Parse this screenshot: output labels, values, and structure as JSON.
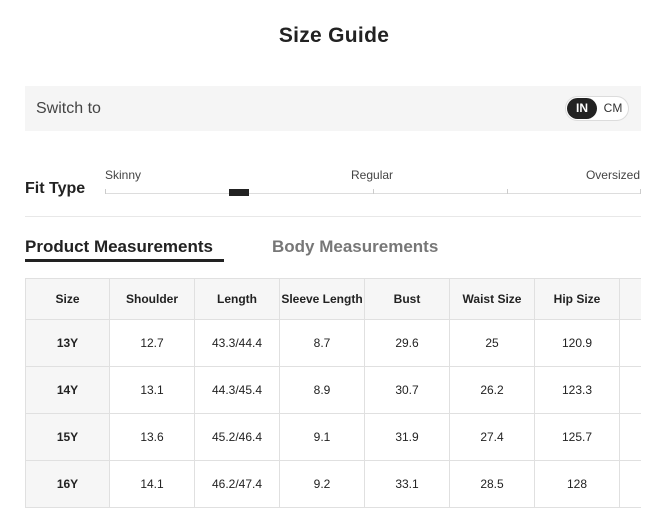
{
  "title": "Size Guide",
  "switch": {
    "label": "Switch to",
    "options": [
      "IN",
      "CM"
    ],
    "selected": "IN"
  },
  "fit_type": {
    "label": "Fit Type",
    "options": [
      "Skinny",
      "Regular",
      "Oversized"
    ],
    "level": 0.25
  },
  "tabs": [
    {
      "label": "Product Measurements",
      "active": true
    },
    {
      "label": "Body Measurements",
      "active": false
    }
  ],
  "table": {
    "headers": [
      "Size",
      "Shoulder",
      "Length",
      "Sleeve Length",
      "Bust",
      "Waist Size",
      "Hip Size",
      ""
    ],
    "rows": [
      [
        "13Y",
        "12.7",
        "43.3/44.4",
        "8.7",
        "29.6",
        "25",
        "120.9",
        ""
      ],
      [
        "14Y",
        "13.1",
        "44.3/45.4",
        "8.9",
        "30.7",
        "26.2",
        "123.3",
        ""
      ],
      [
        "15Y",
        "13.6",
        "45.2/46.4",
        "9.1",
        "31.9",
        "27.4",
        "125.7",
        ""
      ],
      [
        "16Y",
        "14.1",
        "46.2/47.4",
        "9.2",
        "33.1",
        "28.5",
        "128",
        ""
      ]
    ]
  },
  "colors": {
    "accent": "#222222",
    "panel": "#f5f5f5",
    "inactive_tab": "#777777"
  }
}
